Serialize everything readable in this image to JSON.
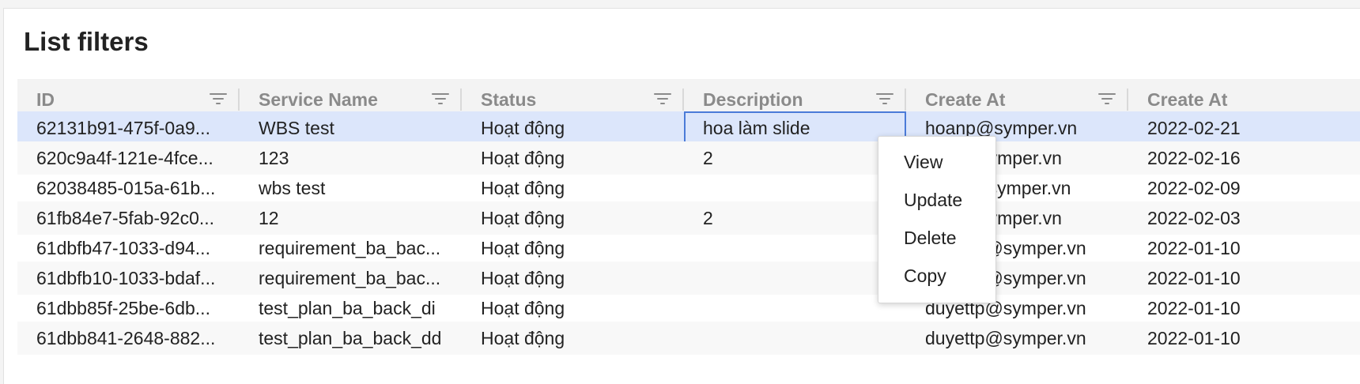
{
  "page": {
    "title": "List filters"
  },
  "columns": [
    {
      "label": "ID"
    },
    {
      "label": "Service Name"
    },
    {
      "label": "Status"
    },
    {
      "label": "Description"
    },
    {
      "label": "Create At"
    },
    {
      "label": "Create At"
    }
  ],
  "rows": [
    {
      "id": "62131b91-475f-0a9...",
      "service": "WBS test",
      "status": "Hoạt động",
      "description": "hoa làm slide",
      "created_by": "hoanp@symper.vn",
      "created_at": "2022-02-21"
    },
    {
      "id": "620c9a4f-121e-4fce...",
      "service": "123",
      "status": "Hoạt động",
      "description": "2",
      "created_by": "qaht@symper.vn",
      "created_at": "2022-02-16"
    },
    {
      "id": "62038485-015a-61b...",
      "service": "wbs test",
      "status": "Hoạt động",
      "description": "",
      "created_by": "loantt@symper.vn",
      "created_at": "2022-02-09"
    },
    {
      "id": "61fb84e7-5fab-92c0...",
      "service": "12",
      "status": "Hoạt động",
      "description": "2",
      "created_by": "qaht@symper.vn",
      "created_at": "2022-02-03"
    },
    {
      "id": "61dbfb47-1033-d94...",
      "service": "requirement_ba_bac...",
      "status": "Hoạt động",
      "description": "",
      "created_by": "duyettp@symper.vn",
      "created_at": "2022-01-10"
    },
    {
      "id": "61dbfb10-1033-bdaf...",
      "service": "requirement_ba_bac...",
      "status": "Hoạt động",
      "description": "",
      "created_by": "duyettp@symper.vn",
      "created_at": "2022-01-10"
    },
    {
      "id": "61dbb85f-25be-6db...",
      "service": "test_plan_ba_back_di",
      "status": "Hoạt động",
      "description": "",
      "created_by": "duyettp@symper.vn",
      "created_at": "2022-01-10"
    },
    {
      "id": "61dbb841-2648-882...",
      "service": "test_plan_ba_back_dd",
      "status": "Hoạt động",
      "description": "",
      "created_by": "duyettp@symper.vn",
      "created_at": "2022-01-10"
    }
  ],
  "context_menu": {
    "items": [
      {
        "label": "View"
      },
      {
        "label": "Update"
      },
      {
        "label": "Delete"
      },
      {
        "label": "Copy"
      }
    ]
  },
  "colors": {
    "selected_row": "#dce6fb",
    "focus_border": "#4b7bd8",
    "header_bg": "#f3f3f3",
    "header_text": "#8a8a8a"
  }
}
